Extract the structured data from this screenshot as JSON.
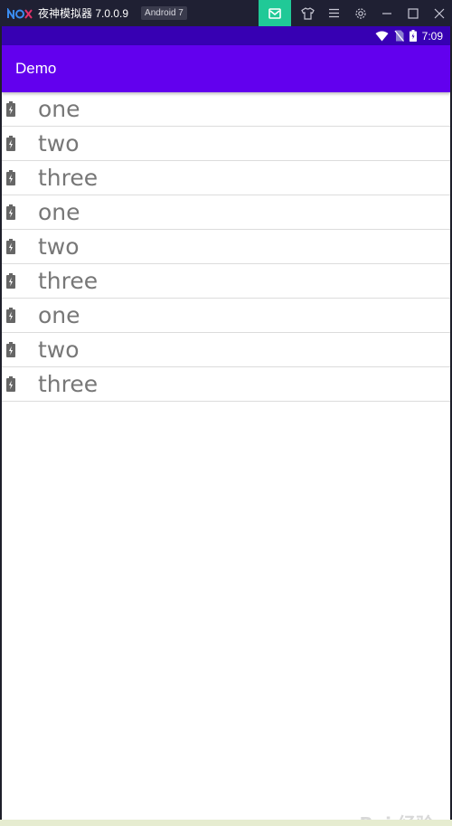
{
  "emulator": {
    "logo_text": "nox",
    "title": "夜神模拟器 7.0.0.9",
    "android_badge": "Android 7",
    "controls": [
      "mail-icon",
      "shirt-icon",
      "menu-icon",
      "gear-icon",
      "minimize-icon",
      "maximize-icon",
      "close-icon"
    ],
    "mail_button_color": "#20c997"
  },
  "status_bar": {
    "time": "7:09",
    "icons": [
      "wifi-icon",
      "no-sim-icon",
      "battery-icon"
    ],
    "color": "#3700b3"
  },
  "app_bar": {
    "title": "Demo",
    "color": "#6200ee"
  },
  "list": {
    "items": [
      {
        "label": "one",
        "icon": "battery-charging-icon"
      },
      {
        "label": "two",
        "icon": "battery-charging-icon"
      },
      {
        "label": "three",
        "icon": "battery-charging-icon"
      },
      {
        "label": "one",
        "icon": "battery-charging-icon"
      },
      {
        "label": "two",
        "icon": "battery-charging-icon"
      },
      {
        "label": "three",
        "icon": "battery-charging-icon"
      },
      {
        "label": "one",
        "icon": "battery-charging-icon"
      },
      {
        "label": "two",
        "icon": "battery-charging-icon"
      },
      {
        "label": "three",
        "icon": "battery-charging-icon"
      }
    ]
  },
  "watermark": "Bai 经验"
}
